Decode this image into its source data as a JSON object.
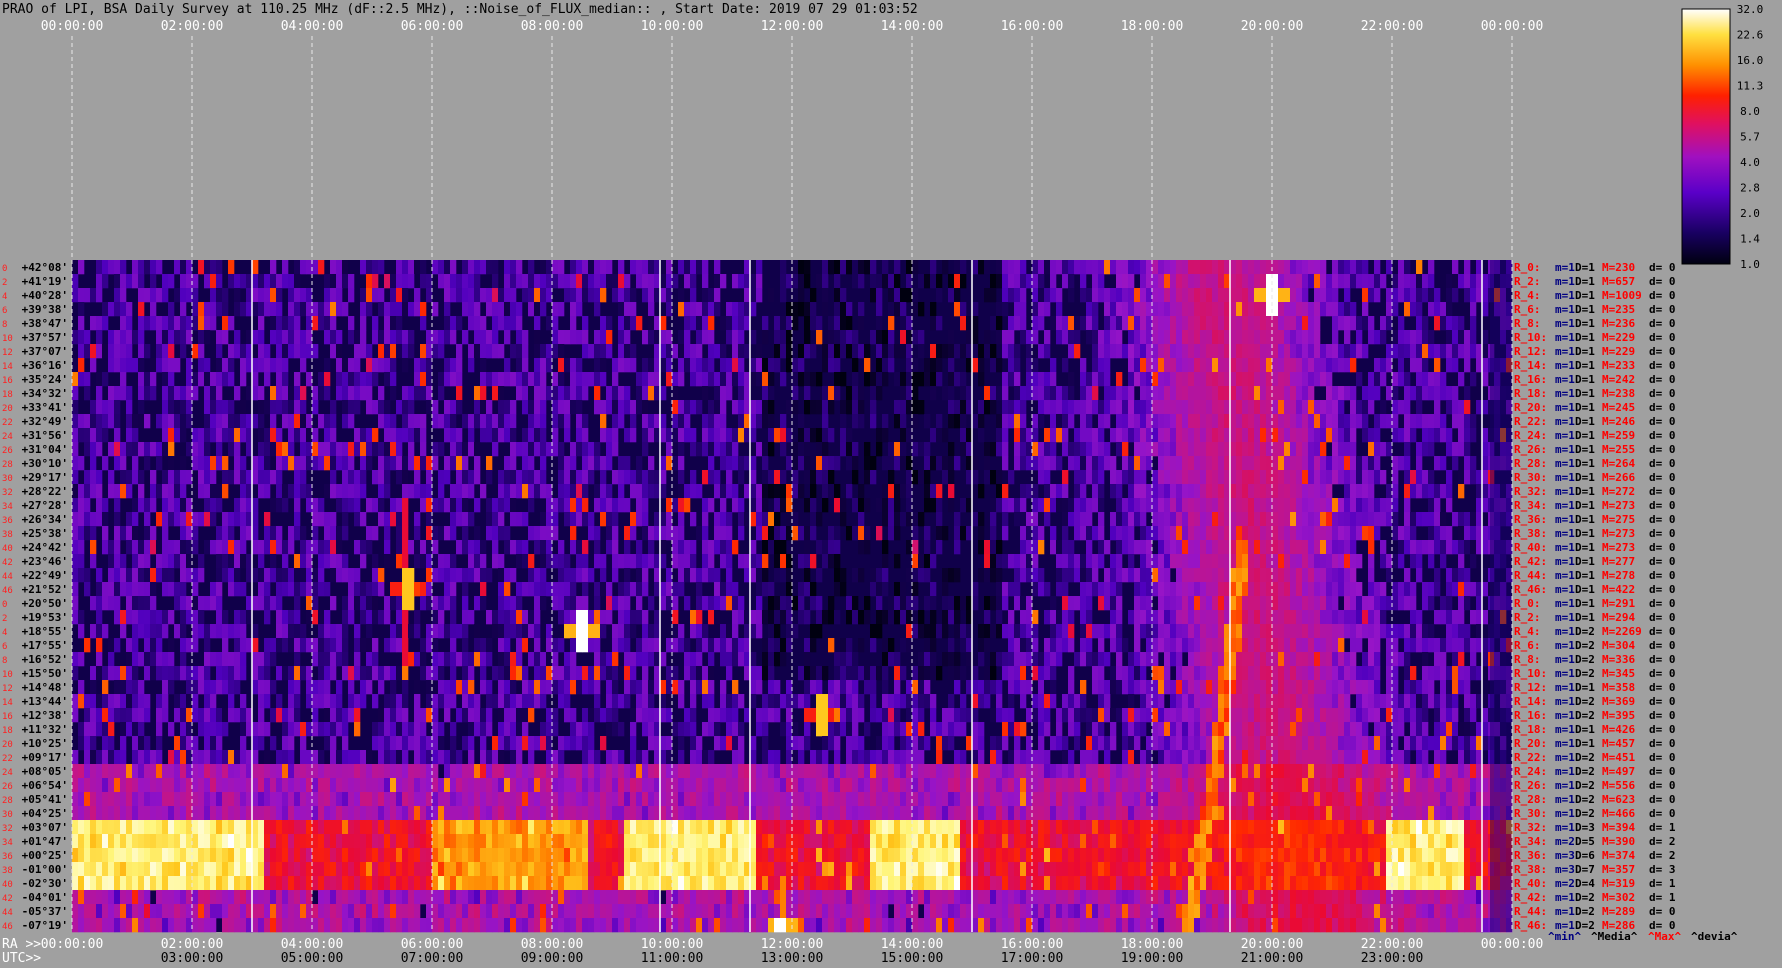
{
  "title": "PRAO of LPI, BSA Daily Survey at 110.25 MHz (dF::2.5 MHz), ::Noise_of_FLUX_median:: , Start Date: 2019 07 29 01:03:52",
  "chart_data": {
    "type": "heatmap",
    "title": "PRAO of LPI, BSA Daily Survey at 110.25 MHz (dF::2.5 MHz), ::Noise_of_FLUX_median:: , Start Date: 2019 07 29 01:03:52",
    "top_axis_labels": [
      "00:00:00",
      "02:00:00",
      "04:00:00",
      "06:00:00",
      "08:00:00",
      "10:00:00",
      "12:00:00",
      "14:00:00",
      "16:00:00",
      "18:00:00",
      "20:00:00",
      "22:00:00",
      "00:00:00"
    ],
    "ra_axis_prefix": "RA >>",
    "ra_axis_labels": [
      "00:00:00",
      "02:00:00",
      "04:00:00",
      "06:00:00",
      "08:00:00",
      "10:00:00",
      "12:00:00",
      "14:00:00",
      "16:00:00",
      "18:00:00",
      "20:00:00",
      "22:00:00",
      "00:00:00"
    ],
    "utc_axis_prefix": "UTC>>",
    "utc_axis_labels": [
      "03:00:00",
      "05:00:00",
      "07:00:00",
      "09:00:00",
      "11:00:00",
      "13:00:00",
      "15:00:00",
      "17:00:00",
      "19:00:00",
      "21:00:00",
      "23:00:00"
    ],
    "declinations": [
      "+42°08'",
      "+41°19'",
      "+40°28'",
      "+39°38'",
      "+38°47'",
      "+37°57'",
      "+37°07'",
      "+36°16'",
      "+35°24'",
      "+34°32'",
      "+33°41'",
      "+32°49'",
      "+31°56'",
      "+31°04'",
      "+30°10'",
      "+29°17'",
      "+28°22'",
      "+27°28'",
      "+26°34'",
      "+25°38'",
      "+24°42'",
      "+23°46'",
      "+22°49'",
      "+21°52'",
      "+20°50'",
      "+19°53'",
      "+18°55'",
      "+17°55'",
      "+16°52'",
      "+15°50'",
      "+14°48'",
      "+13°44'",
      "+12°38'",
      "+11°32'",
      "+10°25'",
      "+09°17'",
      "+08°05'",
      "+06°54'",
      "+05°41'",
      "+04°25'",
      "+03°07'",
      "+01°47'",
      "+00°25'",
      "-01°00'",
      "-02°30'",
      "-04°01'",
      "-05°37'",
      "-07°19'"
    ],
    "beam_numbers": [
      "0",
      "2",
      "4",
      "6",
      "8",
      "10",
      "12",
      "14",
      "16",
      "18",
      "20",
      "22",
      "24",
      "26",
      "28",
      "30",
      "32",
      "34",
      "36",
      "38",
      "40",
      "42",
      "44",
      "46",
      "0",
      "2",
      "4",
      "6",
      "8",
      "10",
      "12",
      "14",
      "16",
      "18",
      "20",
      "22",
      "24",
      "26",
      "28",
      "30",
      "32",
      "34",
      "36",
      "38",
      "40",
      "42",
      "44",
      "46"
    ],
    "row_stats": [
      {
        "r": "R_0:",
        "m": "m=1",
        "D": "D=1",
        "M": "M=230",
        "d": "d= 0"
      },
      {
        "r": "R_2:",
        "m": "m=1",
        "D": "D=1",
        "M": "M=657",
        "d": "d= 0"
      },
      {
        "r": "R_4:",
        "m": "m=1",
        "D": "D=1",
        "M": "M=1009",
        "d": "d= 0"
      },
      {
        "r": "R_6:",
        "m": "m=1",
        "D": "D=1",
        "M": "M=235",
        "d": "d= 0"
      },
      {
        "r": "R_8:",
        "m": "m=1",
        "D": "D=1",
        "M": "M=236",
        "d": "d= 0"
      },
      {
        "r": "R_10:",
        "m": "m=1",
        "D": "D=1",
        "M": "M=229",
        "d": "d= 0"
      },
      {
        "r": "R_12:",
        "m": "m=1",
        "D": "D=1",
        "M": "M=229",
        "d": "d= 0"
      },
      {
        "r": "R_14:",
        "m": "m=1",
        "D": "D=1",
        "M": "M=233",
        "d": "d= 0"
      },
      {
        "r": "R_16:",
        "m": "m=1",
        "D": "D=1",
        "M": "M=242",
        "d": "d= 0"
      },
      {
        "r": "R_18:",
        "m": "m=1",
        "D": "D=1",
        "M": "M=238",
        "d": "d= 0"
      },
      {
        "r": "R_20:",
        "m": "m=1",
        "D": "D=1",
        "M": "M=245",
        "d": "d= 0"
      },
      {
        "r": "R_22:",
        "m": "m=1",
        "D": "D=1",
        "M": "M=246",
        "d": "d= 0"
      },
      {
        "r": "R_24:",
        "m": "m=1",
        "D": "D=1",
        "M": "M=259",
        "d": "d= 0"
      },
      {
        "r": "R_26:",
        "m": "m=1",
        "D": "D=1",
        "M": "M=255",
        "d": "d= 0"
      },
      {
        "r": "R_28:",
        "m": "m=1",
        "D": "D=1",
        "M": "M=264",
        "d": "d= 0"
      },
      {
        "r": "R_30:",
        "m": "m=1",
        "D": "D=1",
        "M": "M=266",
        "d": "d= 0"
      },
      {
        "r": "R_32:",
        "m": "m=1",
        "D": "D=1",
        "M": "M=272",
        "d": "d= 0"
      },
      {
        "r": "R_34:",
        "m": "m=1",
        "D": "D=1",
        "M": "M=273",
        "d": "d= 0"
      },
      {
        "r": "R_36:",
        "m": "m=1",
        "D": "D=1",
        "M": "M=275",
        "d": "d= 0"
      },
      {
        "r": "R_38:",
        "m": "m=1",
        "D": "D=1",
        "M": "M=273",
        "d": "d= 0"
      },
      {
        "r": "R_40:",
        "m": "m=1",
        "D": "D=1",
        "M": "M=273",
        "d": "d= 0"
      },
      {
        "r": "R_42:",
        "m": "m=1",
        "D": "D=1",
        "M": "M=277",
        "d": "d= 0"
      },
      {
        "r": "R_44:",
        "m": "m=1",
        "D": "D=1",
        "M": "M=278",
        "d": "d= 0"
      },
      {
        "r": "R_46:",
        "m": "m=1",
        "D": "D=1",
        "M": "M=422",
        "d": "d= 0"
      },
      {
        "r": "R_0:",
        "m": "m=1",
        "D": "D=1",
        "M": "M=291",
        "d": "d= 0"
      },
      {
        "r": "R_2:",
        "m": "m=1",
        "D": "D=1",
        "M": "M=294",
        "d": "d= 0"
      },
      {
        "r": "R_4:",
        "m": "m=1",
        "D": "D=2",
        "M": "M=2269",
        "d": "d= 0"
      },
      {
        "r": "R_6:",
        "m": "m=1",
        "D": "D=2",
        "M": "M=304",
        "d": "d= 0"
      },
      {
        "r": "R_8:",
        "m": "m=1",
        "D": "D=2",
        "M": "M=336",
        "d": "d= 0"
      },
      {
        "r": "R_10:",
        "m": "m=1",
        "D": "D=2",
        "M": "M=345",
        "d": "d= 0"
      },
      {
        "r": "R_12:",
        "m": "m=1",
        "D": "D=1",
        "M": "M=358",
        "d": "d= 0"
      },
      {
        "r": "R_14:",
        "m": "m=1",
        "D": "D=2",
        "M": "M=369",
        "d": "d= 0"
      },
      {
        "r": "R_16:",
        "m": "m=1",
        "D": "D=2",
        "M": "M=395",
        "d": "d= 0"
      },
      {
        "r": "R_18:",
        "m": "m=1",
        "D": "D=1",
        "M": "M=426",
        "d": "d= 0"
      },
      {
        "r": "R_20:",
        "m": "m=1",
        "D": "D=1",
        "M": "M=457",
        "d": "d= 0"
      },
      {
        "r": "R_22:",
        "m": "m=1",
        "D": "D=2",
        "M": "M=451",
        "d": "d= 0"
      },
      {
        "r": "R_24:",
        "m": "m=1",
        "D": "D=2",
        "M": "M=497",
        "d": "d= 0"
      },
      {
        "r": "R_26:",
        "m": "m=1",
        "D": "D=2",
        "M": "M=556",
        "d": "d= 0"
      },
      {
        "r": "R_28:",
        "m": "m=1",
        "D": "D=2",
        "M": "M=623",
        "d": "d= 0"
      },
      {
        "r": "R_30:",
        "m": "m=1",
        "D": "D=2",
        "M": "M=466",
        "d": "d= 0"
      },
      {
        "r": "R_32:",
        "m": "m=1",
        "D": "D=3",
        "M": "M=394",
        "d": "d= 1"
      },
      {
        "r": "R_34:",
        "m": "m=2",
        "D": "D=5",
        "M": "M=390",
        "d": "d= 2"
      },
      {
        "r": "R_36:",
        "m": "m=3",
        "D": "D=6",
        "M": "M=374",
        "d": "d= 2"
      },
      {
        "r": "R_38:",
        "m": "m=3",
        "D": "D=7",
        "M": "M=357",
        "d": "d= 3"
      },
      {
        "r": "R_40:",
        "m": "m=2",
        "D": "D=4",
        "M": "M=319",
        "d": "d= 1"
      },
      {
        "r": "R_42:",
        "m": "m=1",
        "D": "D=2",
        "M": "M=302",
        "d": "d= 1"
      },
      {
        "r": "R_44:",
        "m": "m=1",
        "D": "D=2",
        "M": "M=289",
        "d": "d= 0"
      },
      {
        "r": "R_46:",
        "m": "m=1",
        "D": "D=2",
        "M": "M=286",
        "d": "d= 0"
      }
    ],
    "stats_footer": [
      {
        "text": "^min^",
        "color": "#000080"
      },
      {
        "text": "^Media^",
        "color": "#000000"
      },
      {
        "text": "^Max^",
        "color": "#ff0000"
      },
      {
        "text": "^devia^",
        "color": "#000000"
      }
    ],
    "colorbar_ticks": [
      "32.0",
      "22.6",
      "16.0",
      "11.3",
      "8.0",
      "5.7",
      "4.0",
      "2.8",
      "2.0",
      "1.4",
      "1.0"
    ],
    "colorbar_range": [
      1.0,
      32.0
    ],
    "colorbar_scale": "log",
    "bright_sources": [
      {
        "ra": "20:00",
        "dec": "+40°28'",
        "value": 32
      },
      {
        "ra": "08:30",
        "dec": "+18°55'",
        "value": 32
      },
      {
        "ra": "05:35",
        "dec": "+21°52'",
        "value": 16
      },
      {
        "ra": "11:50",
        "dec": "-07°19'",
        "value": 32
      },
      {
        "ra": "12:30",
        "dec": "+12°38'",
        "value": 16
      }
    ],
    "grid": true,
    "colors": {
      "background": "#a0a0a0",
      "row_label_dec": "#000000",
      "row_label_r": "#ff0000",
      "stat_m": "#000080",
      "stat_M": "#ff0000"
    }
  }
}
